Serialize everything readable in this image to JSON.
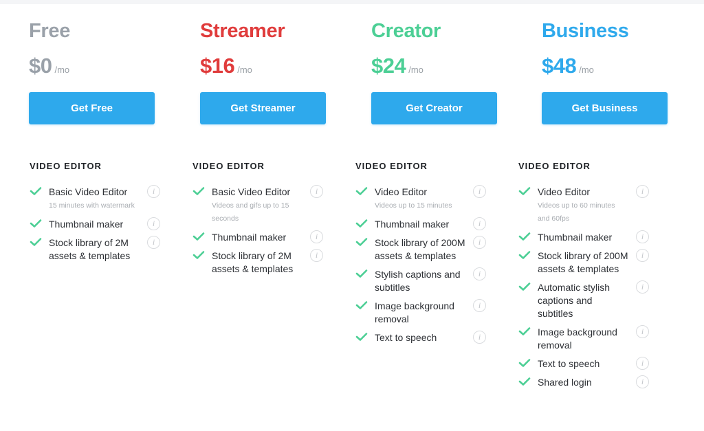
{
  "plans": [
    {
      "name": "Free",
      "color": "#9aa1a9",
      "price": "$0",
      "period": "/mo",
      "cta": "Get Free",
      "section": "VIDEO EDITOR",
      "features": [
        {
          "label": "Basic Video Editor",
          "note": "15 minutes with watermark"
        },
        {
          "label": "Thumbnail maker",
          "note": ""
        },
        {
          "label": "Stock library of 2M assets & templates",
          "note": ""
        }
      ]
    },
    {
      "name": "Streamer",
      "color": "#e03c3c",
      "price": "$16",
      "period": "/mo",
      "cta": "Get Streamer",
      "section": "VIDEO EDITOR",
      "features": [
        {
          "label": "Basic Video Editor",
          "note": "Videos and gifs up to 15 seconds"
        },
        {
          "label": "Thumbnail maker",
          "note": ""
        },
        {
          "label": "Stock library of 2M assets & templates",
          "note": ""
        }
      ]
    },
    {
      "name": "Creator",
      "color": "#4ccf95",
      "price": "$24",
      "period": "/mo",
      "cta": "Get Creator",
      "section": "VIDEO EDITOR",
      "features": [
        {
          "label": "Video Editor",
          "note": "Videos up to 15 minutes"
        },
        {
          "label": "Thumbnail maker",
          "note": ""
        },
        {
          "label": "Stock library of 200M assets & templates",
          "note": ""
        },
        {
          "label": "Stylish captions and subtitles",
          "note": ""
        },
        {
          "label": "Image background removal",
          "note": ""
        },
        {
          "label": "Text to speech",
          "note": ""
        }
      ]
    },
    {
      "name": "Business",
      "color": "#2ea9ec",
      "price": "$48",
      "period": "/mo",
      "cta": "Get Business",
      "section": "VIDEO EDITOR",
      "features": [
        {
          "label": "Video Editor",
          "note": "Videos up to 60 minutes and 60fps"
        },
        {
          "label": "Thumbnail maker",
          "note": ""
        },
        {
          "label": "Stock library of 200M assets & templates",
          "note": ""
        },
        {
          "label": "Automatic stylish captions and subtitles",
          "note": ""
        },
        {
          "label": "Image background removal",
          "note": ""
        },
        {
          "label": "Text to speech",
          "note": ""
        },
        {
          "label": "Shared login",
          "note": ""
        }
      ]
    }
  ],
  "icons": {
    "check": "check-icon",
    "info": "i"
  },
  "colors": {
    "button": "#2ea9ec",
    "check": "#4ccf95"
  }
}
